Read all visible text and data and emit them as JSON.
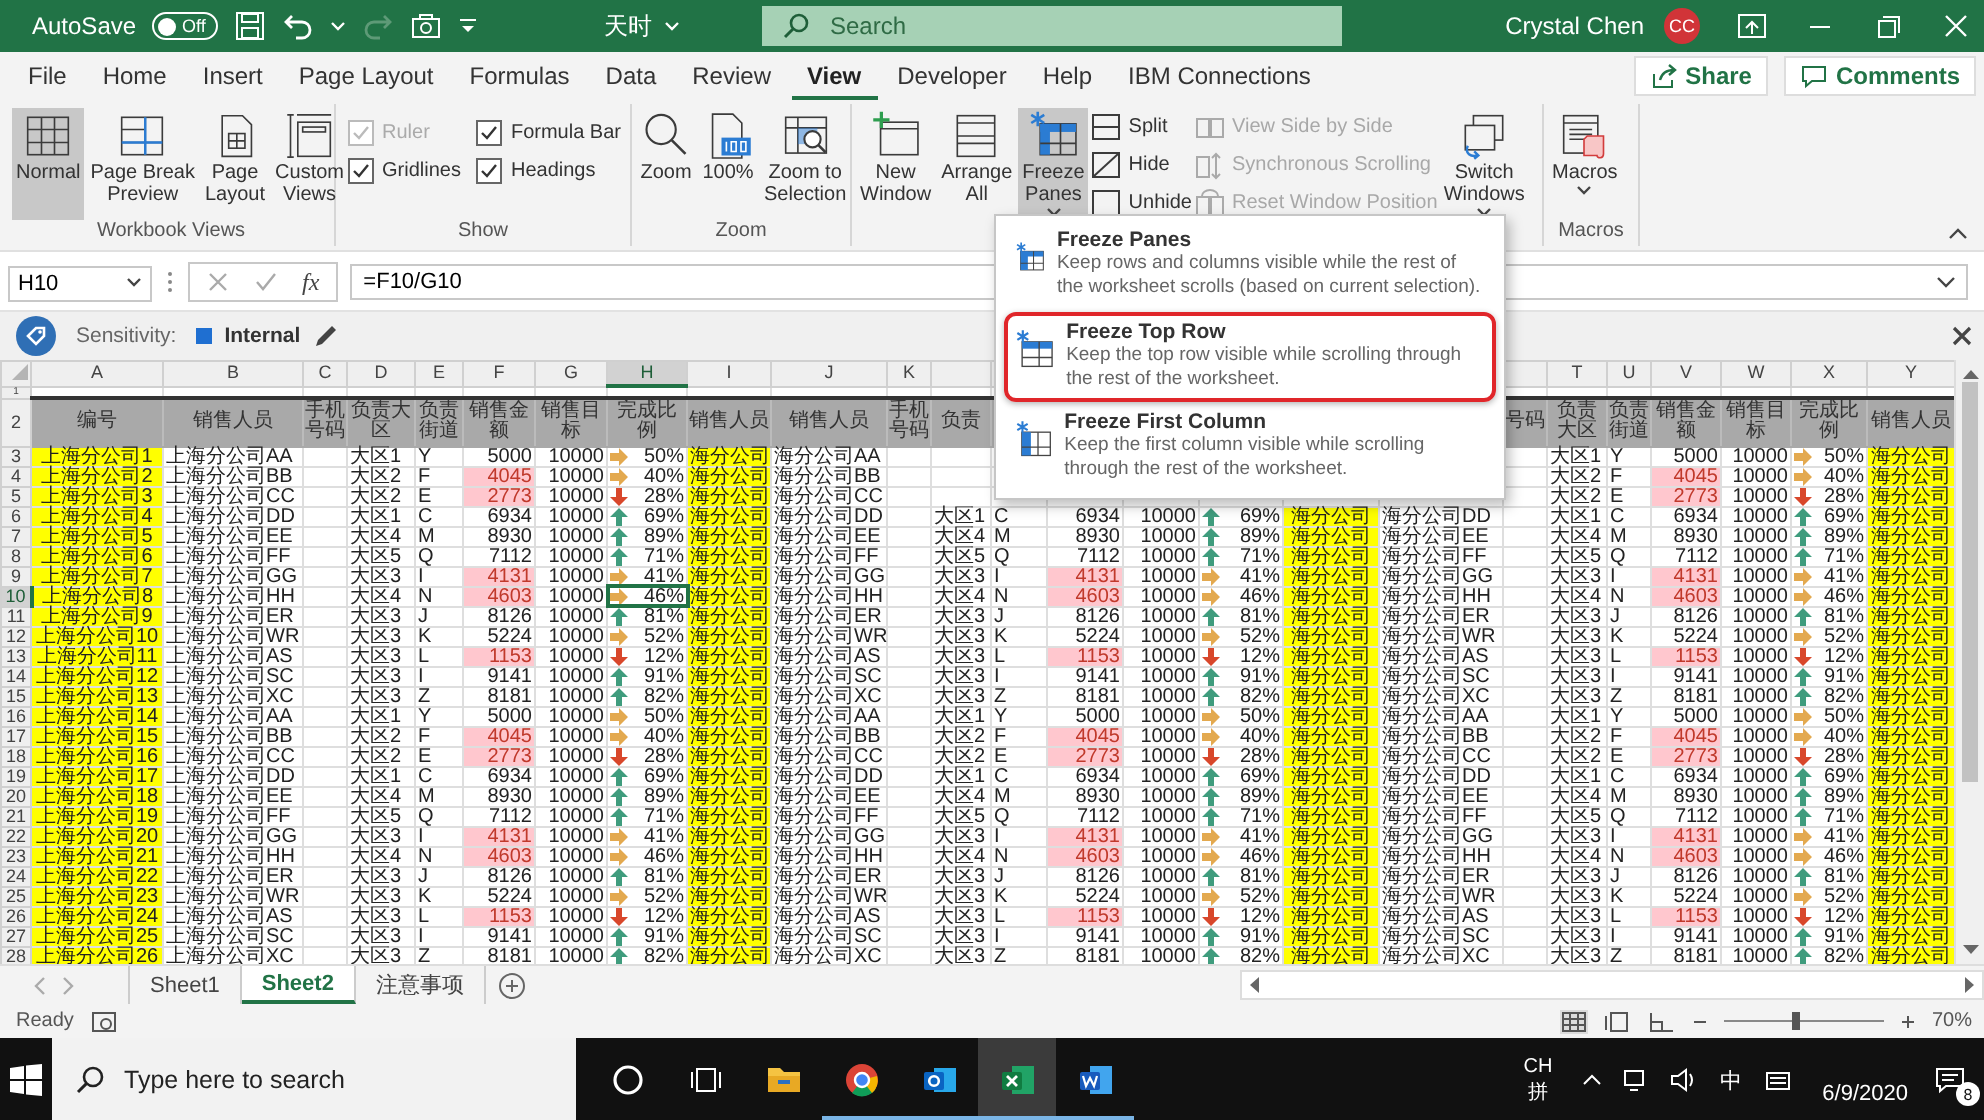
{
  "title_bar": {
    "autosave": "AutoSave",
    "autosave_state": "Off",
    "autosave_on": false,
    "document": "天时",
    "search": {
      "placeholder": "Search"
    },
    "user": "Crystal Chen",
    "avatar": "CC"
  },
  "tabs": [
    {
      "label": "File",
      "selected": false
    },
    {
      "label": "Home",
      "selected": false
    },
    {
      "label": "Insert",
      "selected": false
    },
    {
      "label": "Page Layout",
      "selected": false
    },
    {
      "label": "Formulas",
      "selected": false
    },
    {
      "label": "Data",
      "selected": false
    },
    {
      "label": "Review",
      "selected": false
    },
    {
      "label": "View",
      "selected": true
    },
    {
      "label": "Developer",
      "selected": false
    },
    {
      "label": "Help",
      "selected": false
    },
    {
      "label": "IBM Connections",
      "selected": false
    }
  ],
  "share": "Share",
  "comments": "Comments",
  "ribbon": {
    "groups": [
      {
        "label": "Workbook Views",
        "kind": "buttons",
        "items": [
          {
            "kind": "large",
            "label": "Normal",
            "selected": true
          },
          {
            "kind": "large",
            "label": "Page Break\nPreview",
            "selected": false
          },
          {
            "kind": "large",
            "label": "Page\nLayout",
            "selected": false
          },
          {
            "kind": "large",
            "label": "Custom\nViews",
            "selected": false
          }
        ]
      },
      {
        "label": "Show",
        "kind": "checks",
        "items": [
          {
            "kind": "check",
            "label": "Ruler",
            "checked": true,
            "disabled": true
          },
          {
            "kind": "check",
            "label": "Formula Bar",
            "checked": true,
            "disabled": false
          },
          {
            "kind": "check",
            "label": "Gridlines",
            "checked": true,
            "disabled": false
          },
          {
            "kind": "check",
            "label": "Headings",
            "checked": true,
            "disabled": false
          }
        ]
      },
      {
        "label": "Zoom",
        "kind": "buttons",
        "items": [
          {
            "kind": "large",
            "label": "Zoom",
            "selected": false
          },
          {
            "kind": "large",
            "label": "100%",
            "selected": false
          },
          {
            "kind": "large",
            "label": "Zoom to\nSelection",
            "selected": false
          }
        ]
      },
      {
        "kind": "buttons",
        "items": [
          {
            "kind": "large",
            "label": "New\nWindow",
            "selected": false
          },
          {
            "kind": "large",
            "label": "Arrange\nAll",
            "selected": false
          },
          {
            "kind": "large",
            "label": "Freeze\nPanes",
            "selected": true,
            "dropdown": true
          },
          {
            "kind": "small",
            "label": "Split",
            "disabled": false
          },
          {
            "kind": "small",
            "label": "Hide",
            "disabled": false
          },
          {
            "kind": "small",
            "label": "Unhide",
            "disabled": false
          },
          {
            "kind": "small",
            "label": "View Side by Side",
            "disabled": true
          },
          {
            "kind": "small",
            "label": "Synchronous Scrolling",
            "disabled": true
          },
          {
            "kind": "small",
            "label": "Reset Window Position",
            "disabled": true
          },
          {
            "kind": "large",
            "label": "Switch\nWindows",
            "selected": false,
            "dropdown": true
          }
        ]
      },
      {
        "label": "Macros",
        "kind": "buttons",
        "items": [
          {
            "kind": "large",
            "label": "Macros",
            "selected": false,
            "dropdown": true
          }
        ]
      }
    ]
  },
  "freeze_menu": [
    {
      "title": "Freeze Panes",
      "description": "Keep rows and columns visible while the rest of the worksheet scrolls (based on current selection).",
      "selected": false
    },
    {
      "title": "Freeze Top Row",
      "description": "Keep the top row visible while scrolling through the rest of the worksheet.",
      "selected": true
    },
    {
      "title": "Freeze First Column",
      "description": "Keep the first column visible while scrolling through the rest of the worksheet.",
      "selected": false
    }
  ],
  "formula_bar": {
    "name_box": "H10",
    "function_button": "fx",
    "formula": "=F10/G10"
  },
  "sensitivity": {
    "label": "Sensitivity:",
    "value": "Internal"
  },
  "sheet": {
    "columns": [
      {
        "letter": "A",
        "kind": "id",
        "selected": false
      },
      {
        "letter": "B",
        "kind": "name",
        "selected": false
      },
      {
        "letter": "C",
        "kind": "blank",
        "selected": false
      },
      {
        "letter": "D",
        "kind": "region",
        "selected": false
      },
      {
        "letter": "E",
        "kind": "street",
        "selected": false
      },
      {
        "letter": "F",
        "kind": "amount",
        "selected": false
      },
      {
        "letter": "G",
        "kind": "target",
        "selected": false
      },
      {
        "letter": "H",
        "kind": "ratio",
        "selected": true
      },
      {
        "letter": "I",
        "kind": "id",
        "selected": false
      },
      {
        "letter": "J",
        "kind": "name",
        "selected": false
      },
      {
        "letter": "K",
        "kind": "blank",
        "selected": false
      },
      {
        "kind": "region"
      },
      {
        "kind": "street"
      },
      {
        "kind": "amount"
      },
      {
        "kind": "target"
      },
      {
        "kind": "ratio"
      },
      {
        "kind": "id"
      },
      {
        "kind": "name"
      },
      {
        "kind": "blank"
      },
      {
        "letter": "T",
        "kind": "region",
        "selected": false
      },
      {
        "letter": "U",
        "kind": "street",
        "selected": false
      },
      {
        "letter": "V",
        "kind": "amount",
        "selected": false
      },
      {
        "letter": "W",
        "kind": "target",
        "selected": false
      },
      {
        "letter": "X",
        "kind": "ratio",
        "selected": false
      },
      {
        "letter": "Y",
        "kind": "id",
        "selected": false
      }
    ],
    "blank_row": "1",
    "header_row": {
      "number": "2",
      "cells": [
        "编号",
        "销售人员",
        "手机号码",
        "负责大区",
        "负责街道",
        "销售金额",
        "销售目标",
        "完成比例",
        "销售人员",
        "销售人员",
        "手机号码",
        "负责",
        null,
        null,
        null,
        null,
        null,
        null,
        "号码",
        "负责大区",
        "负责街道",
        "销售金额",
        "销售目标",
        "完成比例",
        "销售人员"
      ]
    },
    "rows": [
      {
        "number": "3",
        "selected": false,
        "low": false,
        "kind": "right",
        "cells": [
          "上海分公司1",
          "上海分公司AA",
          null,
          "大区1",
          "Y",
          "5000",
          "10000",
          "50%",
          "海分公司",
          "海分公司AA",
          null,
          null,
          null,
          null,
          null,
          null,
          null,
          null,
          null,
          "大区1",
          "Y",
          "5000",
          "10000",
          "50%",
          "海分公司"
        ]
      },
      {
        "number": "4",
        "selected": false,
        "low": true,
        "kind": "right",
        "cells": [
          "上海分公司2",
          "上海分公司BB",
          null,
          "大区2",
          "F",
          "4045",
          "10000",
          "40%",
          "海分公司",
          "海分公司BB",
          null,
          null,
          null,
          null,
          null,
          null,
          null,
          null,
          null,
          "大区2",
          "F",
          "4045",
          "10000",
          "40%",
          "海分公司"
        ]
      },
      {
        "number": "5",
        "selected": false,
        "low": true,
        "kind": "down",
        "cells": [
          "上海分公司3",
          "上海分公司CC",
          null,
          "大区2",
          "E",
          "2773",
          "10000",
          "28%",
          "海分公司",
          "海分公司CC",
          null,
          null,
          null,
          null,
          null,
          null,
          null,
          null,
          null,
          "大区2",
          "E",
          "2773",
          "10000",
          "28%",
          "海分公司"
        ]
      },
      {
        "number": "6",
        "selected": false,
        "low": false,
        "kind": "up",
        "cells": [
          "上海分公司4",
          "上海分公司DD",
          null,
          "大区1",
          "C",
          "6934",
          "10000",
          "69%",
          "海分公司",
          "海分公司DD",
          null,
          "大区1",
          "C",
          "6934",
          "10000",
          "69%",
          "海分公司",
          "海分公司DD",
          null,
          "大区1",
          "C",
          "6934",
          "10000",
          "69%",
          "海分公司"
        ]
      },
      {
        "number": "7",
        "selected": false,
        "low": false,
        "kind": "up",
        "cells": [
          "上海分公司5",
          "上海分公司EE",
          null,
          "大区4",
          "M",
          "8930",
          "10000",
          "89%",
          "海分公司",
          "海分公司EE",
          null,
          "大区4",
          "M",
          "8930",
          "10000",
          "89%",
          "海分公司",
          "海分公司EE",
          null,
          "大区4",
          "M",
          "8930",
          "10000",
          "89%",
          "海分公司"
        ]
      },
      {
        "number": "8",
        "selected": false,
        "low": false,
        "kind": "up",
        "cells": [
          "上海分公司6",
          "上海分公司FF",
          null,
          "大区5",
          "Q",
          "7112",
          "10000",
          "71%",
          "海分公司",
          "海分公司FF",
          null,
          "大区5",
          "Q",
          "7112",
          "10000",
          "71%",
          "海分公司",
          "海分公司FF",
          null,
          "大区5",
          "Q",
          "7112",
          "10000",
          "71%",
          "海分公司"
        ]
      },
      {
        "number": "9",
        "selected": false,
        "low": true,
        "kind": "right",
        "cells": [
          "上海分公司7",
          "上海分公司GG",
          null,
          "大区3",
          "I",
          "4131",
          "10000",
          "41%",
          "海分公司",
          "海分公司GG",
          null,
          "大区3",
          "I",
          "4131",
          "10000",
          "41%",
          "海分公司",
          "海分公司GG",
          null,
          "大区3",
          "I",
          "4131",
          "10000",
          "41%",
          "海分公司"
        ]
      },
      {
        "number": "10",
        "selected": true,
        "low": true,
        "kind": "right",
        "cells": [
          "上海分公司8",
          "上海分公司HH",
          null,
          "大区4",
          "N",
          "4603",
          "10000",
          "46%",
          "海分公司",
          "海分公司HH",
          null,
          "大区4",
          "N",
          "4603",
          "10000",
          "46%",
          "海分公司",
          "海分公司HH",
          null,
          "大区4",
          "N",
          "4603",
          "10000",
          "46%",
          "海分公司"
        ]
      },
      {
        "number": "11",
        "selected": false,
        "low": false,
        "kind": "up",
        "cells": [
          "上海分公司9",
          "上海分公司ER",
          null,
          "大区3",
          "J",
          "8126",
          "10000",
          "81%",
          "海分公司",
          "海分公司ER",
          null,
          "大区3",
          "J",
          "8126",
          "10000",
          "81%",
          "海分公司",
          "海分公司ER",
          null,
          "大区3",
          "J",
          "8126",
          "10000",
          "81%",
          "海分公司"
        ]
      },
      {
        "number": "12",
        "selected": false,
        "low": false,
        "kind": "right",
        "cells": [
          "上海分公司10",
          "上海分公司WR",
          null,
          "大区3",
          "K",
          "5224",
          "10000",
          "52%",
          "海分公司",
          "海分公司WR",
          null,
          "大区3",
          "K",
          "5224",
          "10000",
          "52%",
          "海分公司",
          "海分公司WR",
          null,
          "大区3",
          "K",
          "5224",
          "10000",
          "52%",
          "海分公司"
        ]
      },
      {
        "number": "13",
        "selected": false,
        "low": true,
        "kind": "down",
        "cells": [
          "上海分公司11",
          "上海分公司AS",
          null,
          "大区3",
          "L",
          "1153",
          "10000",
          "12%",
          "海分公司",
          "海分公司AS",
          null,
          "大区3",
          "L",
          "1153",
          "10000",
          "12%",
          "海分公司",
          "海分公司AS",
          null,
          "大区3",
          "L",
          "1153",
          "10000",
          "12%",
          "海分公司"
        ]
      },
      {
        "number": "14",
        "selected": false,
        "low": false,
        "kind": "up",
        "cells": [
          "上海分公司12",
          "上海分公司SC",
          null,
          "大区3",
          "I",
          "9141",
          "10000",
          "91%",
          "海分公司",
          "海分公司SC",
          null,
          "大区3",
          "I",
          "9141",
          "10000",
          "91%",
          "海分公司",
          "海分公司SC",
          null,
          "大区3",
          "I",
          "9141",
          "10000",
          "91%",
          "海分公司"
        ]
      },
      {
        "number": "15",
        "selected": false,
        "low": false,
        "kind": "up",
        "cells": [
          "上海分公司13",
          "上海分公司XC",
          null,
          "大区3",
          "Z",
          "8181",
          "10000",
          "82%",
          "海分公司",
          "海分公司XC",
          null,
          "大区3",
          "Z",
          "8181",
          "10000",
          "82%",
          "海分公司",
          "海分公司XC",
          null,
          "大区3",
          "Z",
          "8181",
          "10000",
          "82%",
          "海分公司"
        ]
      },
      {
        "number": "16",
        "selected": false,
        "low": false,
        "kind": "right",
        "cells": [
          "上海分公司14",
          "上海分公司AA",
          null,
          "大区1",
          "Y",
          "5000",
          "10000",
          "50%",
          "海分公司",
          "海分公司AA",
          null,
          "大区1",
          "Y",
          "5000",
          "10000",
          "50%",
          "海分公司",
          "海分公司AA",
          null,
          "大区1",
          "Y",
          "5000",
          "10000",
          "50%",
          "海分公司"
        ]
      },
      {
        "number": "17",
        "selected": false,
        "low": true,
        "kind": "right",
        "cells": [
          "上海分公司15",
          "上海分公司BB",
          null,
          "大区2",
          "F",
          "4045",
          "10000",
          "40%",
          "海分公司",
          "海分公司BB",
          null,
          "大区2",
          "F",
          "4045",
          "10000",
          "40%",
          "海分公司",
          "海分公司BB",
          null,
          "大区2",
          "F",
          "4045",
          "10000",
          "40%",
          "海分公司"
        ]
      },
      {
        "number": "18",
        "selected": false,
        "low": true,
        "kind": "down",
        "cells": [
          "上海分公司16",
          "上海分公司CC",
          null,
          "大区2",
          "E",
          "2773",
          "10000",
          "28%",
          "海分公司",
          "海分公司CC",
          null,
          "大区2",
          "E",
          "2773",
          "10000",
          "28%",
          "海分公司",
          "海分公司CC",
          null,
          "大区2",
          "E",
          "2773",
          "10000",
          "28%",
          "海分公司"
        ]
      },
      {
        "number": "19",
        "selected": false,
        "low": false,
        "kind": "up",
        "cells": [
          "上海分公司17",
          "上海分公司DD",
          null,
          "大区1",
          "C",
          "6934",
          "10000",
          "69%",
          "海分公司",
          "海分公司DD",
          null,
          "大区1",
          "C",
          "6934",
          "10000",
          "69%",
          "海分公司",
          "海分公司DD",
          null,
          "大区1",
          "C",
          "6934",
          "10000",
          "69%",
          "海分公司"
        ]
      },
      {
        "number": "20",
        "selected": false,
        "low": false,
        "kind": "up",
        "cells": [
          "上海分公司18",
          "上海分公司EE",
          null,
          "大区4",
          "M",
          "8930",
          "10000",
          "89%",
          "海分公司",
          "海分公司EE",
          null,
          "大区4",
          "M",
          "8930",
          "10000",
          "89%",
          "海分公司",
          "海分公司EE",
          null,
          "大区4",
          "M",
          "8930",
          "10000",
          "89%",
          "海分公司"
        ]
      },
      {
        "number": "21",
        "selected": false,
        "low": false,
        "kind": "up",
        "cells": [
          "上海分公司19",
          "上海分公司FF",
          null,
          "大区5",
          "Q",
          "7112",
          "10000",
          "71%",
          "海分公司",
          "海分公司FF",
          null,
          "大区5",
          "Q",
          "7112",
          "10000",
          "71%",
          "海分公司",
          "海分公司FF",
          null,
          "大区5",
          "Q",
          "7112",
          "10000",
          "71%",
          "海分公司"
        ]
      },
      {
        "number": "22",
        "selected": false,
        "low": true,
        "kind": "right",
        "cells": [
          "上海分公司20",
          "上海分公司GG",
          null,
          "大区3",
          "I",
          "4131",
          "10000",
          "41%",
          "海分公司",
          "海分公司GG",
          null,
          "大区3",
          "I",
          "4131",
          "10000",
          "41%",
          "海分公司",
          "海分公司GG",
          null,
          "大区3",
          "I",
          "4131",
          "10000",
          "41%",
          "海分公司"
        ]
      },
      {
        "number": "23",
        "selected": false,
        "low": true,
        "kind": "right",
        "cells": [
          "上海分公司21",
          "上海分公司HH",
          null,
          "大区4",
          "N",
          "4603",
          "10000",
          "46%",
          "海分公司",
          "海分公司HH",
          null,
          "大区4",
          "N",
          "4603",
          "10000",
          "46%",
          "海分公司",
          "海分公司HH",
          null,
          "大区4",
          "N",
          "4603",
          "10000",
          "46%",
          "海分公司"
        ]
      },
      {
        "number": "24",
        "selected": false,
        "low": false,
        "kind": "up",
        "cells": [
          "上海分公司22",
          "上海分公司ER",
          null,
          "大区3",
          "J",
          "8126",
          "10000",
          "81%",
          "海分公司",
          "海分公司ER",
          null,
          "大区3",
          "J",
          "8126",
          "10000",
          "81%",
          "海分公司",
          "海分公司ER",
          null,
          "大区3",
          "J",
          "8126",
          "10000",
          "81%",
          "海分公司"
        ]
      },
      {
        "number": "25",
        "selected": false,
        "low": false,
        "kind": "right",
        "cells": [
          "上海分公司23",
          "上海分公司WR",
          null,
          "大区3",
          "K",
          "5224",
          "10000",
          "52%",
          "海分公司",
          "海分公司WR",
          null,
          "大区3",
          "K",
          "5224",
          "10000",
          "52%",
          "海分公司",
          "海分公司WR",
          null,
          "大区3",
          "K",
          "5224",
          "10000",
          "52%",
          "海分公司"
        ]
      },
      {
        "number": "26",
        "selected": false,
        "low": true,
        "kind": "down",
        "cells": [
          "上海分公司24",
          "上海分公司AS",
          null,
          "大区3",
          "L",
          "1153",
          "10000",
          "12%",
          "海分公司",
          "海分公司AS",
          null,
          "大区3",
          "L",
          "1153",
          "10000",
          "12%",
          "海分公司",
          "海分公司AS",
          null,
          "大区3",
          "L",
          "1153",
          "10000",
          "12%",
          "海分公司"
        ]
      },
      {
        "number": "27",
        "selected": false,
        "low": false,
        "kind": "up",
        "cells": [
          "上海分公司25",
          "上海分公司SC",
          null,
          "大区3",
          "I",
          "9141",
          "10000",
          "91%",
          "海分公司",
          "海分公司SC",
          null,
          "大区3",
          "I",
          "9141",
          "10000",
          "91%",
          "海分公司",
          "海分公司SC",
          null,
          "大区3",
          "I",
          "9141",
          "10000",
          "91%",
          "海分公司"
        ]
      },
      {
        "number": "28",
        "selected": false,
        "low": false,
        "kind": "up",
        "cells": [
          "上海分公司26",
          "上海分公司XC",
          null,
          "大区3",
          "Z",
          "8181",
          "10000",
          "82%",
          "海分公司",
          "海分公司XC",
          null,
          "大区3",
          "Z",
          "8181",
          "10000",
          "82%",
          "海分公司",
          "海分公司XC",
          null,
          "大区3",
          "Z",
          "8181",
          "10000",
          "82%",
          "海分公司"
        ]
      }
    ]
  },
  "sheet_tabs": [
    {
      "label": "Sheet1",
      "selected": false
    },
    {
      "label": "Sheet2",
      "selected": true
    },
    {
      "label": "注意事项",
      "selected": false
    }
  ],
  "status_bar": {
    "text": "Ready",
    "zoom": "70%",
    "zoom_slider": {
      "level": 0.45
    }
  },
  "taskbar": {
    "search": {
      "placeholder": "Type here to search"
    },
    "apps": [
      {
        "running": false,
        "active": false
      },
      {
        "running": false,
        "active": false
      },
      {
        "running": false,
        "active": false
      },
      {
        "running": true,
        "active": false
      },
      {
        "running": true,
        "active": false
      },
      {
        "running": true,
        "active": true
      },
      {
        "running": true,
        "active": false
      }
    ],
    "input_language": "CH",
    "input_method": "拼",
    "ime_mode": "中",
    "date": "6/9/2020",
    "notifications": "8"
  }
}
